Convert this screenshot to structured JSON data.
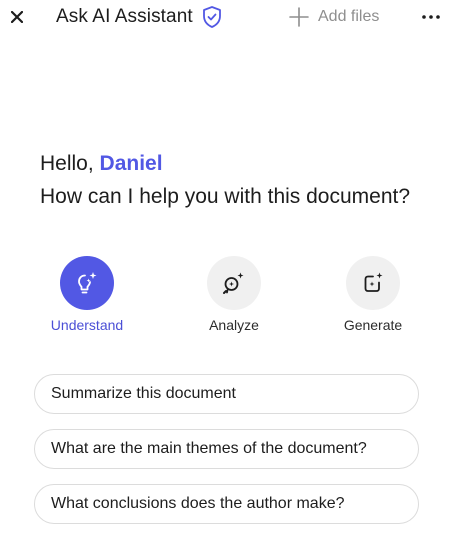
{
  "header": {
    "title": "Ask AI Assistant",
    "add_files_label": "Add files",
    "icons": [
      "close-icon",
      "shield-check-icon",
      "plus-icon",
      "more-icon"
    ]
  },
  "greeting": {
    "hello": "Hello,",
    "user_name": "Daniel",
    "prompt": "How can I help you with this document?"
  },
  "modes": [
    {
      "label": "Understand",
      "icon": "lightbulb-sparkle-icon",
      "active": true
    },
    {
      "label": "Analyze",
      "icon": "magnify-sparkle-icon",
      "active": false
    },
    {
      "label": "Generate",
      "icon": "document-sparkle-icon",
      "active": false
    }
  ],
  "suggestions": [
    "Summarize this document",
    "What are the main themes of the document?",
    "What conclusions does the author make?"
  ],
  "colors": {
    "accent": "#5258e4",
    "text": "#1d1d1d",
    "muted": "#8e8e8e",
    "border": "#dcdcdc"
  }
}
